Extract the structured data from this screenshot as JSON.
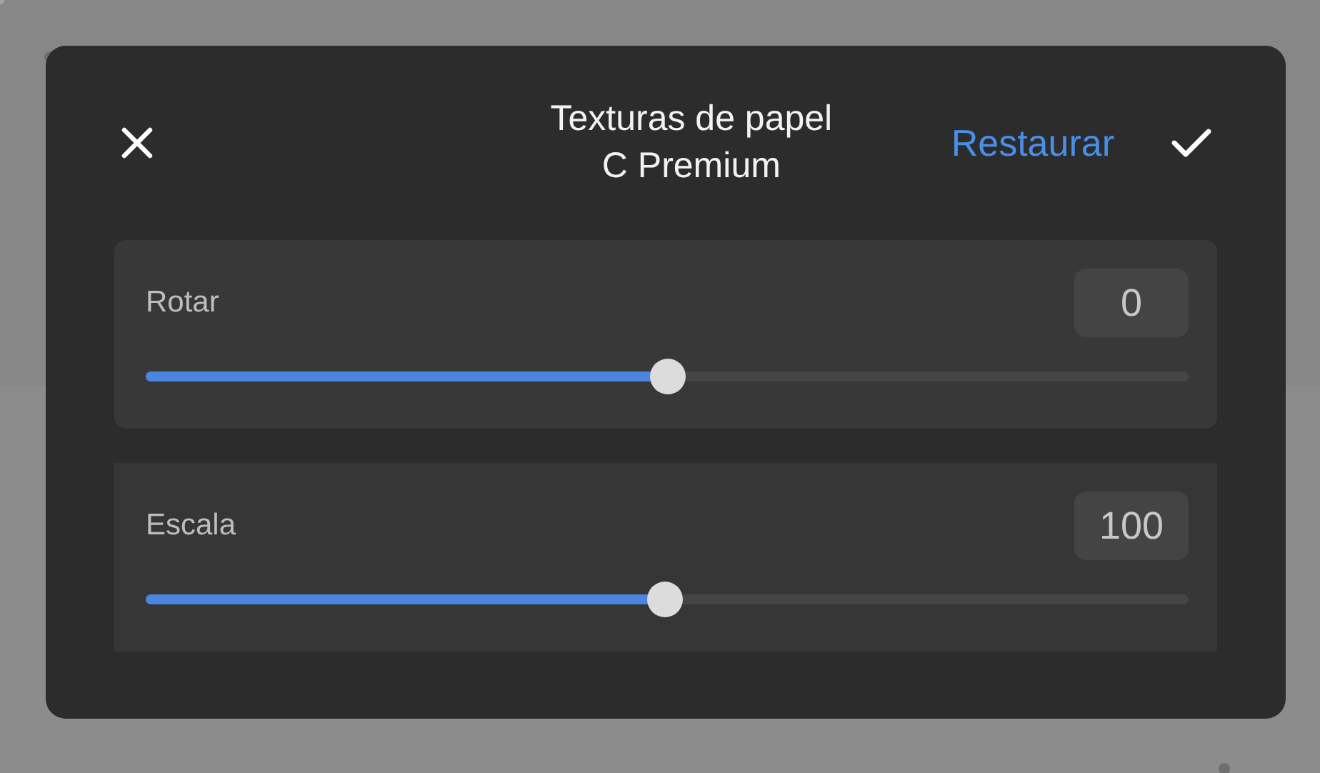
{
  "dialog": {
    "title": "Texturas de papel",
    "subtitle": "C Premium",
    "reset_label": "Restaurar"
  },
  "settings": [
    {
      "label": "Rotar",
      "value": "0",
      "level": 0.5
    },
    {
      "label": "Escala",
      "value": "100",
      "level": 0.497
    }
  ]
}
